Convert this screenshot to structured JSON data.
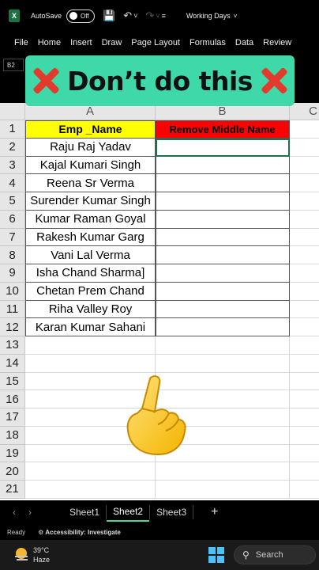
{
  "titlebar": {
    "app_icon": "X",
    "autosave_label": "AutoSave",
    "autosave_state": "Off",
    "document_title": "Working Days",
    "icons": [
      "excel-logo-icon",
      "save-icon",
      "undo-icon",
      "redo-icon",
      "customize-icon"
    ]
  },
  "ribbon": {
    "tabs": [
      "File",
      "Home",
      "Insert",
      "Draw",
      "Page Layout",
      "Formulas",
      "Data",
      "Review"
    ]
  },
  "formula_bar": {
    "name_box": "B2"
  },
  "banner": {
    "text": "Don’t do this",
    "bg_color": "#3fd8a9",
    "icon": "cross-mark-icon"
  },
  "sheet": {
    "columns": [
      "A",
      "B",
      "C"
    ],
    "rows": [
      "1",
      "2",
      "3",
      "4",
      "5",
      "6",
      "7",
      "8",
      "9",
      "10",
      "11",
      "12",
      "13",
      "14",
      "15",
      "16",
      "17",
      "18",
      "19",
      "20",
      "21"
    ],
    "header_a": "Emp _Name",
    "header_b": "Remove Middle Name",
    "header_a_color": "#ffff00",
    "header_b_color": "#ff0000",
    "names": [
      "Raju Raj Yadav",
      "Kajal Kumari Singh",
      "Reena Sr Verma",
      "Surender Kumar Singh",
      "Kumar Raman Goyal",
      "Rakesh Kumar Garg",
      "Vani Lal Verma",
      "Isha Chand Sharma]",
      "Chetan Prem Chand",
      "Riha Valley Roy",
      "Karan Kumar Sahani"
    ]
  },
  "sheet_tabs": {
    "tabs": [
      "Sheet1",
      "Sheet2",
      "Sheet3"
    ],
    "active": "Sheet2",
    "add_label": "+"
  },
  "status_bar": {
    "ready": "Ready",
    "accessibility": "Accessibility: Investigate"
  },
  "taskbar": {
    "temperature": "39°C",
    "condition": "Haze",
    "search_label": "Search"
  },
  "overlay": {
    "emoji": "pointing-up-hand-icon"
  }
}
